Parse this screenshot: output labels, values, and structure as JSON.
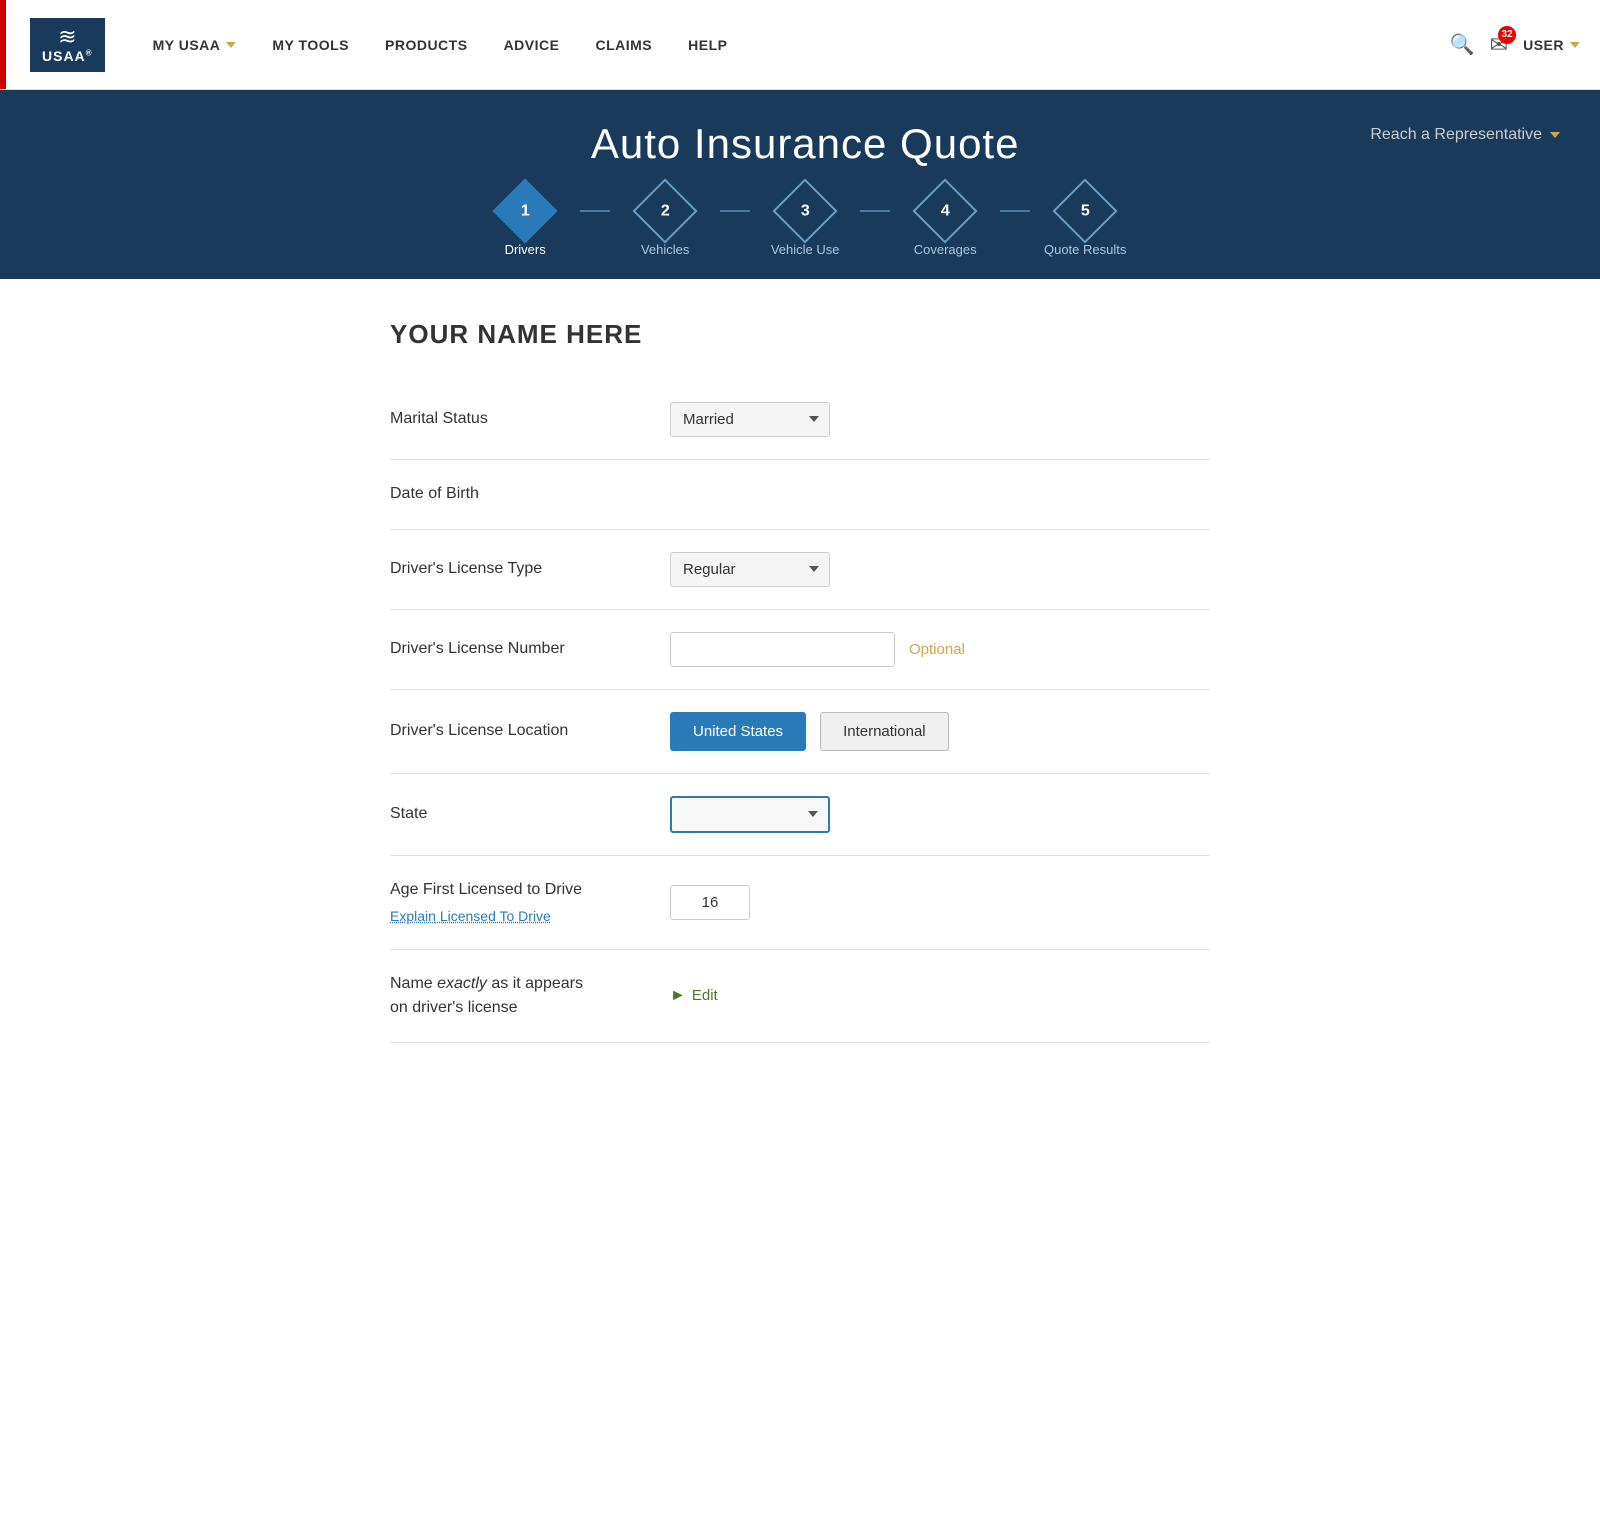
{
  "nav": {
    "logo_text": "USAA",
    "logo_reg": "®",
    "links": [
      {
        "label": "MY USAA",
        "has_chevron": true
      },
      {
        "label": "MY TOOLS",
        "has_chevron": false
      },
      {
        "label": "PRODUCTS",
        "has_chevron": false
      },
      {
        "label": "ADVICE",
        "has_chevron": false
      },
      {
        "label": "CLAIMS",
        "has_chevron": false
      },
      {
        "label": "HELP",
        "has_chevron": false
      }
    ],
    "user_label": "USER",
    "mail_badge": "32"
  },
  "header": {
    "title": "Auto Insurance Quote",
    "reach_rep": "Reach a Representative"
  },
  "steps": [
    {
      "number": "1",
      "label": "Drivers",
      "active": true
    },
    {
      "number": "2",
      "label": "Vehicles",
      "active": false
    },
    {
      "number": "3",
      "label": "Vehicle Use",
      "active": false
    },
    {
      "number": "4",
      "label": "Coverages",
      "active": false
    },
    {
      "number": "5",
      "label": "Quote Results",
      "active": false
    }
  ],
  "form": {
    "user_name": "YOUR NAME HERE",
    "fields": {
      "marital_status_label": "Marital Status",
      "marital_status_value": "Married",
      "date_of_birth_label": "Date of Birth",
      "license_type_label": "Driver's License Type",
      "license_type_value": "Regular",
      "license_number_label": "Driver's License Number",
      "license_number_placeholder": "",
      "optional_label": "Optional",
      "license_location_label": "Driver's License Location",
      "united_states_btn": "United States",
      "international_btn": "International",
      "state_label": "State",
      "age_label": "Age First Licensed to Drive",
      "explain_label": "Explain",
      "licensed_to_drive_link": "Licensed To Drive",
      "age_value": "16",
      "name_on_license_label": "Name exactly as it appears on driver's license",
      "name_italic": "exactly",
      "edit_link": "Edit"
    }
  }
}
